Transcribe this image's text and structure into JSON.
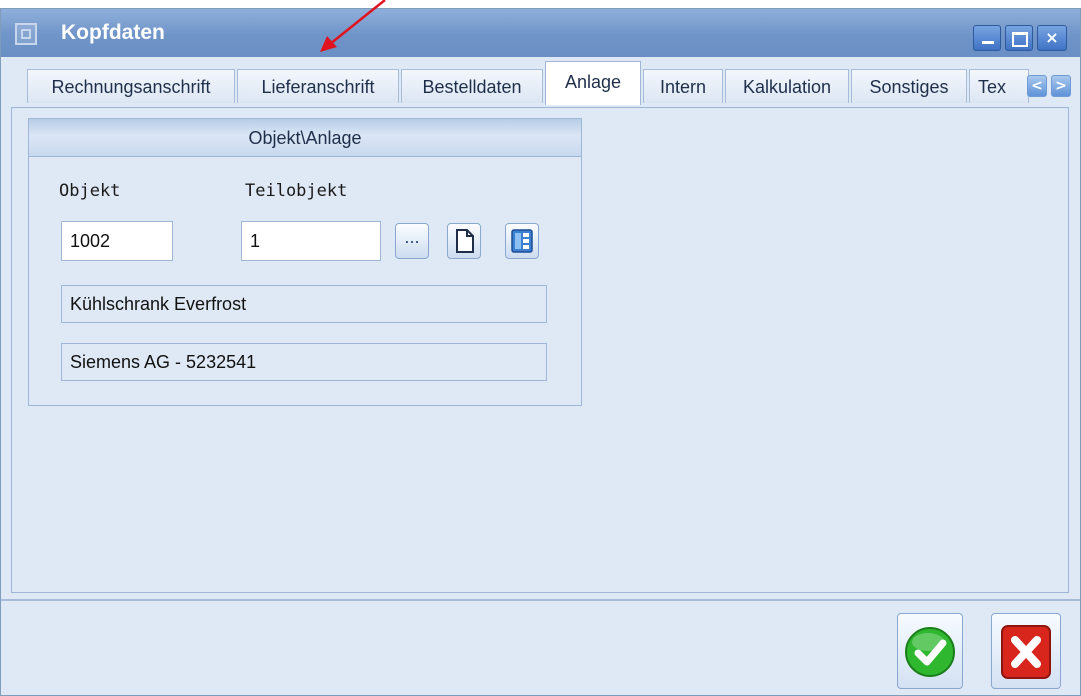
{
  "window": {
    "title": "Kopfdaten"
  },
  "tabs": [
    {
      "label": "Rechnungsanschrift",
      "active": false
    },
    {
      "label": "Lieferanschrift",
      "active": false
    },
    {
      "label": "Bestelldaten",
      "active": false
    },
    {
      "label": "Anlage",
      "active": true
    },
    {
      "label": "Intern",
      "active": false
    },
    {
      "label": "Kalkulation",
      "active": false
    },
    {
      "label": "Sonstiges",
      "active": false
    },
    {
      "label": "Tex",
      "active": false
    }
  ],
  "tab_scroll": {
    "left": "<",
    "right": ">"
  },
  "group": {
    "title": "Objekt\\Anlage",
    "objekt_label": "Objekt",
    "teilobjekt_label": "Teilobjekt",
    "objekt_value": "1002",
    "teilobjekt_value": "1",
    "browse_label": "...",
    "description": "Kühlschrank Everfrost",
    "manufacturer": "Siemens AG - 5232541"
  },
  "colors": {
    "titlebar": "#6f94c8",
    "window_bg": "#dfe9f5",
    "ok_green": "#2fb82f",
    "cancel_red": "#d8261c",
    "annotation_arrow": "#e0141e"
  },
  "icons": [
    "app-icon",
    "minimize-icon",
    "maximize-icon",
    "close-icon",
    "new-document-icon",
    "details-panel-icon",
    "checkmark-icon",
    "cancel-x-icon"
  ]
}
